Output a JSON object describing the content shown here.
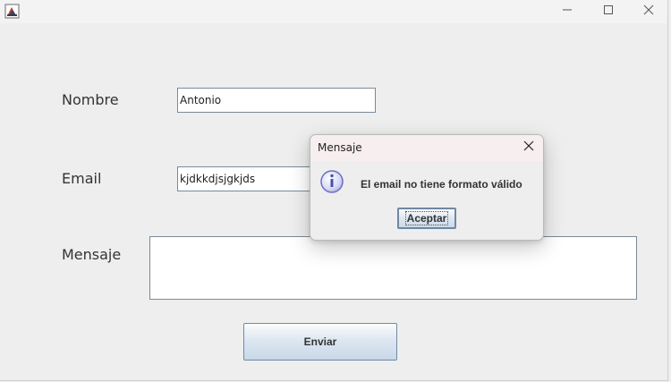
{
  "window": {
    "title": "",
    "icons": {
      "app": "java-app-icon",
      "minimize": "minimize-icon",
      "maximize": "maximize-icon",
      "close": "close-icon"
    }
  },
  "form": {
    "nombre_label": "Nombre",
    "nombre_value": "Antonio",
    "email_label": "Email",
    "email_value": "kjdkkdjsjgkjds",
    "mensaje_label": "Mensaje",
    "mensaje_value": "",
    "submit_label": "Enviar"
  },
  "dialog": {
    "title": "Mensaje",
    "message": "El email no tiene formato válido",
    "ok_label": "Aceptar",
    "icon": "info-icon"
  },
  "colors": {
    "background": "#eeeeee",
    "field_border": "#7a8a99",
    "button_border": "#6d8aa8",
    "info_icon": "#6b6fc9"
  }
}
